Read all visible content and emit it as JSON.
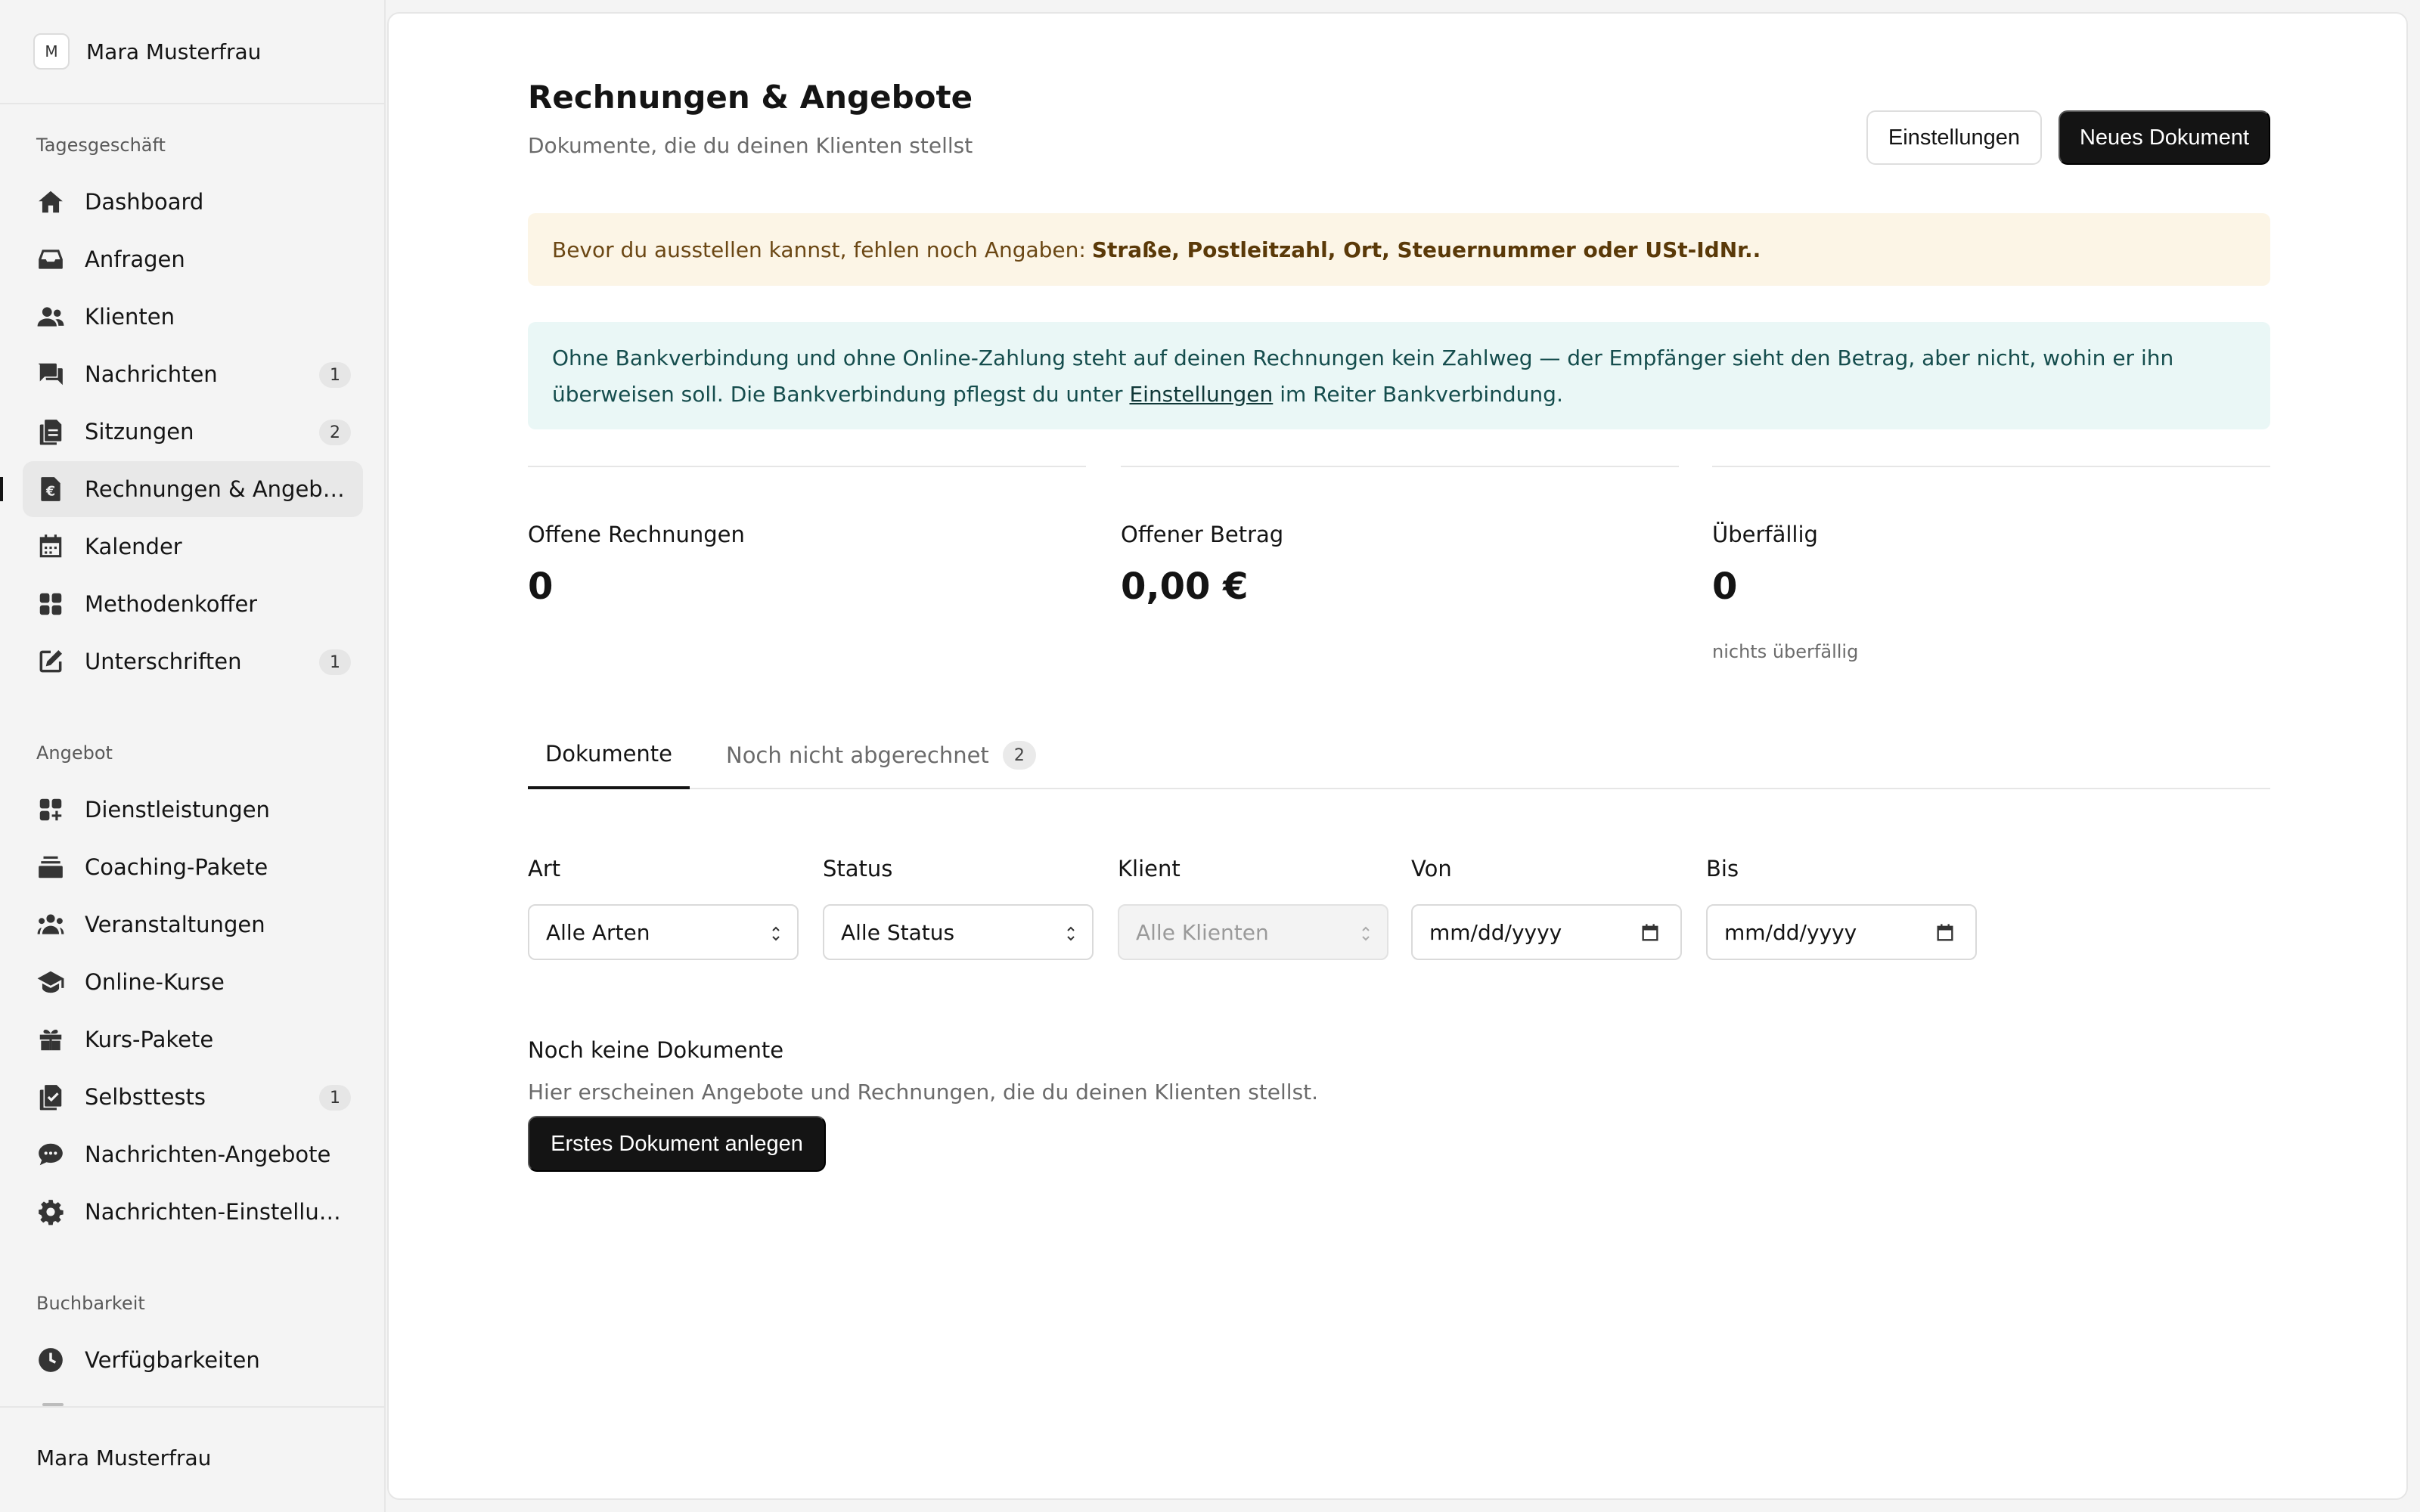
{
  "sidebar": {
    "workspace_initial": "M",
    "workspace_name": "Mara Musterfrau",
    "sections": {
      "tagesgeschaeft": "Tagesgeschäft",
      "angebot": "Angebot",
      "buchbarkeit": "Buchbarkeit"
    },
    "items": [
      {
        "label": "Dashboard",
        "icon": "home-icon"
      },
      {
        "label": "Anfragen",
        "icon": "inbox-icon"
      },
      {
        "label": "Klienten",
        "icon": "users-icon"
      },
      {
        "label": "Nachrichten",
        "icon": "chat-icon",
        "badge": "1"
      },
      {
        "label": "Sitzungen",
        "icon": "documents-icon",
        "badge": "2"
      },
      {
        "label": "Rechnungen & Angebote",
        "icon": "euro-document-icon",
        "active": true
      },
      {
        "label": "Kalender",
        "icon": "calendar-icon"
      },
      {
        "label": "Methodenkoffer",
        "icon": "grid-icon"
      },
      {
        "label": "Unterschriften",
        "icon": "pen-square-icon",
        "badge": "1"
      },
      {
        "label": "Dienstleistungen",
        "icon": "apps-plus-icon"
      },
      {
        "label": "Coaching-Pakete",
        "icon": "stack-icon"
      },
      {
        "label": "Veranstaltungen",
        "icon": "group-icon"
      },
      {
        "label": "Online-Kurse",
        "icon": "graduation-cap-icon"
      },
      {
        "label": "Kurs-Pakete",
        "icon": "gift-icon"
      },
      {
        "label": "Selbsttests",
        "icon": "checklist-icon",
        "badge": "1"
      },
      {
        "label": "Nachrichten-Angebote",
        "icon": "message-bubble-icon"
      },
      {
        "label": "Nachrichten-Einstellungen",
        "icon": "gear-icon"
      },
      {
        "label": "Verfügbarkeiten",
        "icon": "clock-icon"
      }
    ],
    "footer_name": "Mara Musterfrau"
  },
  "header": {
    "title": "Rechnungen & Angebote",
    "subtitle": "Dokumente, die du deinen Klienten stellst",
    "settings_button": "Einstellungen",
    "new_button": "Neues Dokument"
  },
  "warning": {
    "text": "Bevor du ausstellen kannst, fehlen noch Angaben:",
    "missing": "Straße, Postleitzahl, Ort, Steuernummer oder USt-IdNr..",
    "color": "#fcf5e6"
  },
  "info": {
    "text_before": "Ohne Bankverbindung und ohne Online-Zahlung steht auf deinen Rechnungen kein Zahlweg — der Empfänger sieht den Betrag, aber nicht, wohin er ihn überweisen soll. Die Bankverbindung pflegst du unter",
    "link": "Einstellungen",
    "text_after": "im Reiter Bankverbindung.",
    "color": "#eaf7f6"
  },
  "stats": [
    {
      "label": "Offene Rechnungen",
      "value": "0"
    },
    {
      "label": "Offener Betrag",
      "value": "0,00 €"
    },
    {
      "label": "Überfällig",
      "value": "0",
      "sub": "nichts überfällig"
    }
  ],
  "tabs": [
    {
      "label": "Dokumente",
      "active": true
    },
    {
      "label": "Noch nicht abgerechnet",
      "badge": "2"
    }
  ],
  "filters": {
    "art": {
      "label": "Art",
      "value": "Alle Arten"
    },
    "status": {
      "label": "Status",
      "value": "Alle Status"
    },
    "klient": {
      "label": "Klient",
      "value": "Alle Klienten"
    },
    "von": {
      "label": "Von",
      "placeholder": "mm/dd/yyyy"
    },
    "bis": {
      "label": "Bis",
      "placeholder": "mm/dd/yyyy"
    }
  },
  "empty_state": {
    "title": "Noch keine Dokumente",
    "text": "Hier erscheinen Angebote und Rechnungen, die du deinen Klienten stellst.",
    "button": "Erstes Dokument anlegen"
  },
  "colors": {
    "accent": "#141414",
    "background": "#f4f4f4"
  }
}
